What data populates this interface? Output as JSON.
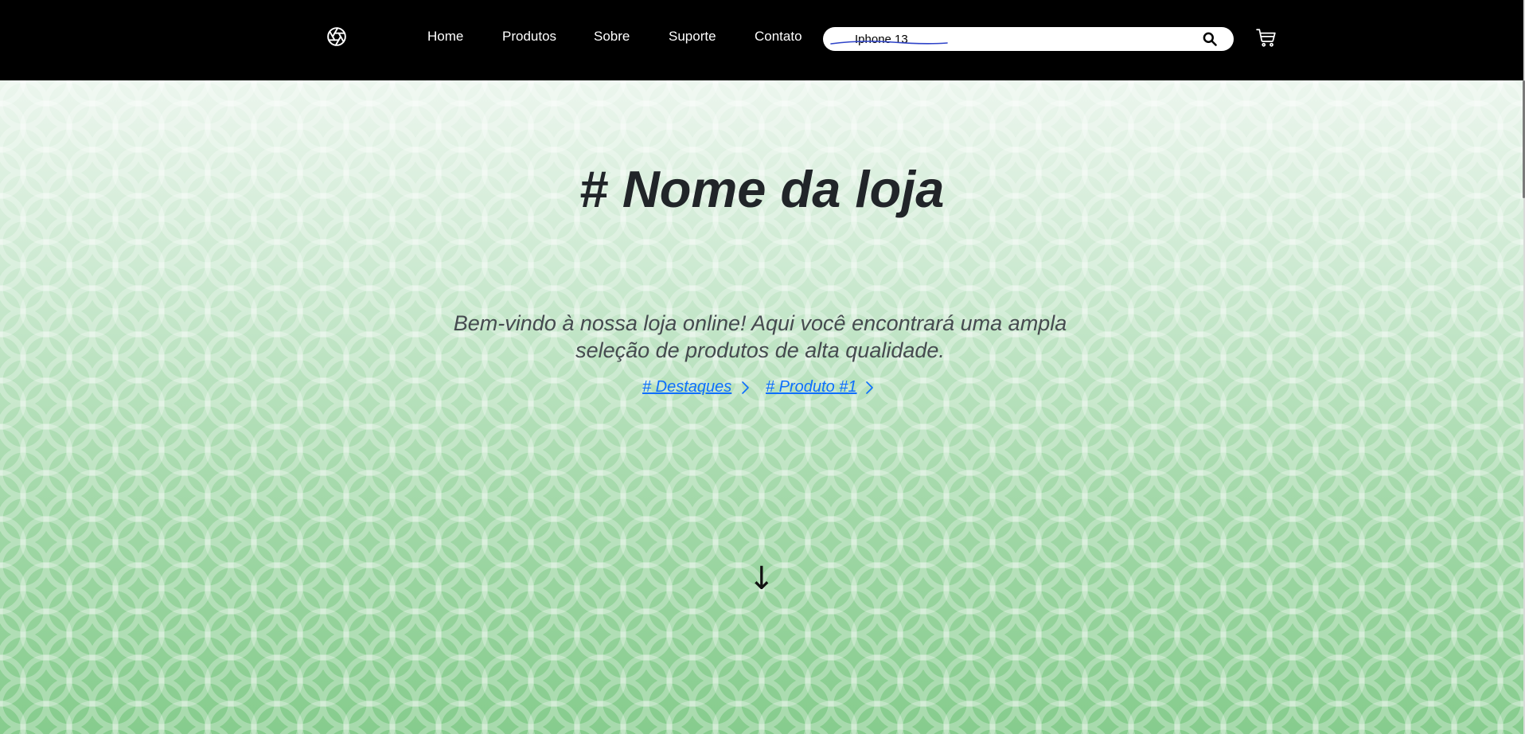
{
  "navbar": {
    "logo_icon": "aperture-icon",
    "links": [
      {
        "label": "Home"
      },
      {
        "label": "Produtos"
      },
      {
        "label": "Sobre"
      },
      {
        "label": "Suporte"
      },
      {
        "label": "Contato"
      }
    ],
    "search": {
      "value": "Iphone 13",
      "icon": "search-icon"
    },
    "cart_icon": "cart-icon"
  },
  "hero": {
    "title": "# Nome da loja",
    "description": "Bem-vindo à nossa loja online! Aqui você encontrará uma ampla seleção de produtos de alta qualidade.",
    "links": [
      {
        "label": "# Destaques"
      },
      {
        "label": "# Produto #1"
      }
    ],
    "scroll_arrow": "↓"
  },
  "colors": {
    "navbar_bg": "#000000",
    "link_color": "#0d6efd",
    "title_color": "#212529",
    "hero_gradient_top": "#ecf6ee",
    "hero_gradient_bottom": "#86cc8d"
  }
}
